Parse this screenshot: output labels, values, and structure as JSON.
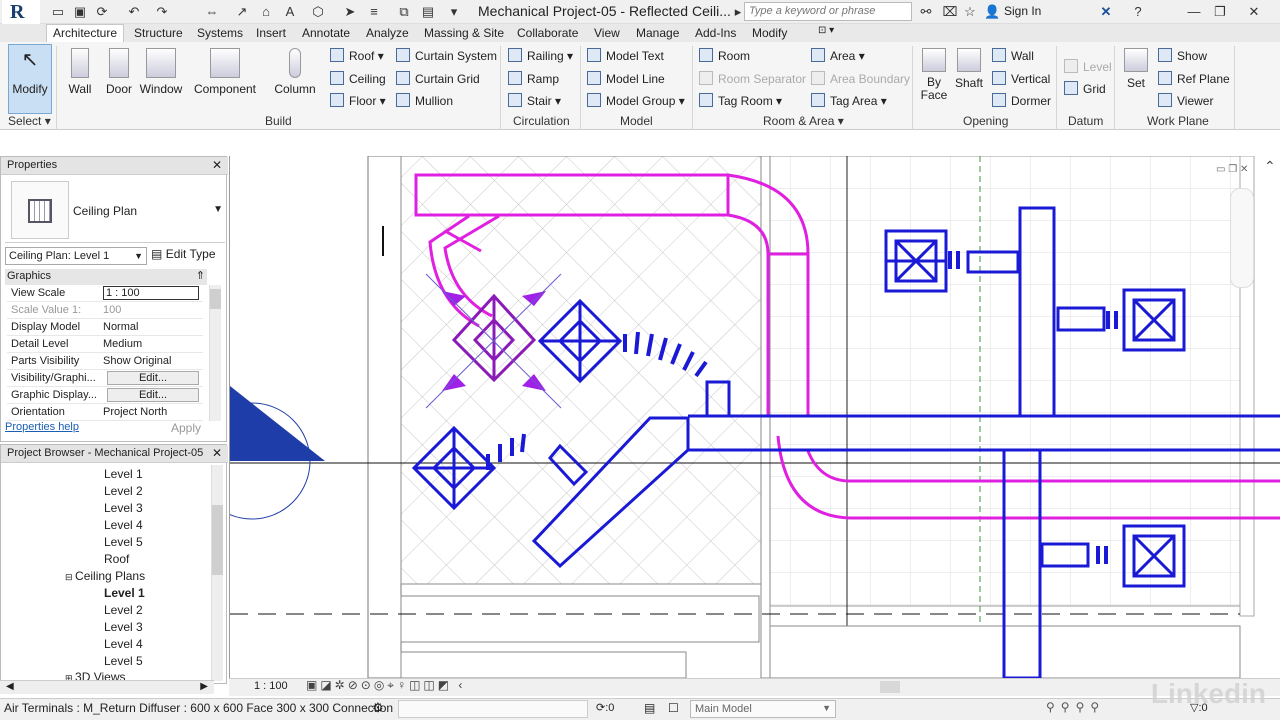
{
  "window": {
    "title": "Mechanical Project-05 - Reflected Ceili...",
    "search_placeholder": "Type a keyword or phrase",
    "sign_in": "Sign In"
  },
  "ribbon_tabs": [
    "Architecture",
    "Structure",
    "Systems",
    "Insert",
    "Annotate",
    "Analyze",
    "Massing & Site",
    "Collaborate",
    "View",
    "Manage",
    "Add-Ins",
    "Modify"
  ],
  "ribbon": {
    "select": {
      "modify": "Modify",
      "label": "Select"
    },
    "build": {
      "wall": "Wall",
      "door": "Door",
      "window": "Window",
      "component": "Component",
      "column": "Column",
      "roof": "Roof",
      "ceiling": "Ceiling",
      "floor": "Floor",
      "curtain_system": "Curtain System",
      "curtain_grid": "Curtain Grid",
      "mullion": "Mullion",
      "label": "Build"
    },
    "circulation": {
      "railing": "Railing",
      "ramp": "Ramp",
      "stair": "Stair",
      "label": "Circulation"
    },
    "model": {
      "model_text": "Model Text",
      "model_line": "Model Line",
      "model_group": "Model Group",
      "label": "Model"
    },
    "room_area": {
      "room": "Room",
      "room_separator": "Room Separator",
      "tag_room": "Tag Room",
      "area": "Area",
      "area_boundary": "Area Boundary",
      "tag_area": "Tag Area",
      "label": "Room & Area"
    },
    "opening": {
      "by_face": "By Face",
      "shaft": "Shaft",
      "wall": "Wall",
      "vertical": "Vertical",
      "dormer": "Dormer",
      "label": "Opening"
    },
    "datum": {
      "level": "Level",
      "grid": "Grid",
      "label": "Datum"
    },
    "work_plane": {
      "set": "Set",
      "show": "Show",
      "ref_plane": "Ref Plane",
      "viewer": "Viewer",
      "label": "Work Plane"
    }
  },
  "properties": {
    "title": "Properties",
    "type_name": "Ceiling Plan",
    "instance_selector": "Ceiling Plan: Level 1",
    "edit_type": "Edit Type",
    "group": "Graphics",
    "rows": [
      {
        "k": "View Scale",
        "v": "1 : 100"
      },
      {
        "k": "Scale Value    1:",
        "v": "100"
      },
      {
        "k": "Display Model",
        "v": "Normal"
      },
      {
        "k": "Detail Level",
        "v": "Medium"
      },
      {
        "k": "Parts Visibility",
        "v": "Show Original"
      },
      {
        "k": "Visibility/Graphi...",
        "v": "Edit..."
      },
      {
        "k": "Graphic Display...",
        "v": "Edit..."
      },
      {
        "k": "Orientation",
        "v": "Project North"
      }
    ],
    "help": "Properties help",
    "apply": "Apply"
  },
  "project_browser": {
    "title": "Project Browser - Mechanical Project-05",
    "floor_levels": [
      "Level 1",
      "Level 2",
      "Level 3",
      "Level 4",
      "Level 5",
      "Roof"
    ],
    "ceiling_group": "Ceiling Plans",
    "ceiling_levels": [
      "Level 1",
      "Level 2",
      "Level 3",
      "Level 4",
      "Level 5"
    ],
    "views_3d": "3D Views"
  },
  "view_control": {
    "scale": "1 : 100"
  },
  "status": {
    "text": "Air Terminals : M_Return Diffuser : 600 x 600 Face 300 x 300 Connection",
    "zero1": ":0",
    "main_model": "Main Model",
    "zero2": ":0"
  },
  "colors": {
    "duct_blue": "#1a1ad6",
    "magenta": "#e020e0",
    "selected": "#8b1bb8",
    "grid_green": "#3a9a3a"
  },
  "watermark": "Linkedin"
}
